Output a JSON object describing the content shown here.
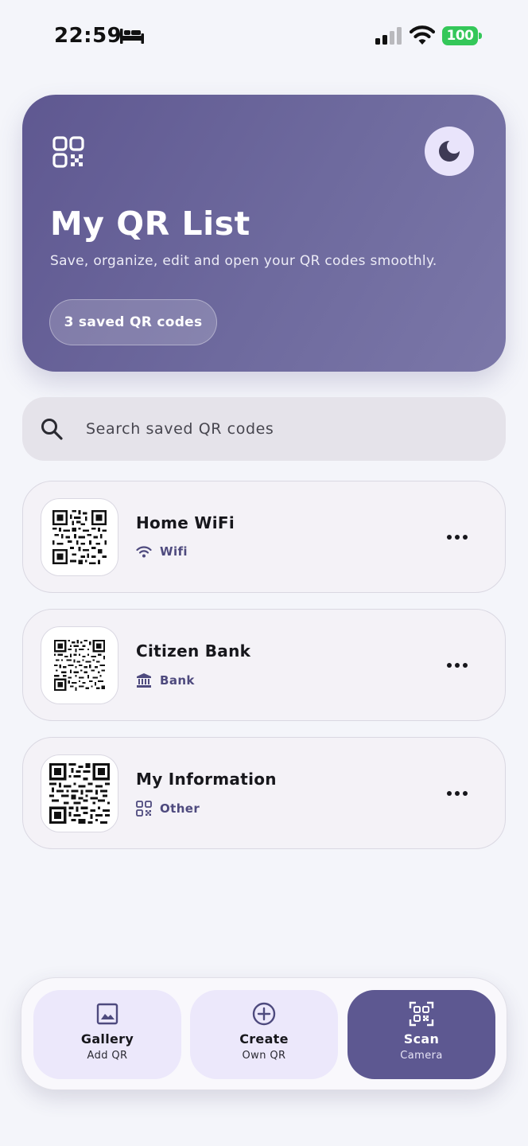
{
  "status_bar": {
    "time": "22:59",
    "battery_level": "100",
    "icons": [
      "bed-icon",
      "cellular-signal-icon",
      "wifi-icon",
      "battery-icon"
    ]
  },
  "hero": {
    "logo_icon": "qr-code-icon",
    "theme_toggle_icon": "moon-icon",
    "title": "My QR List",
    "subtitle": "Save, organize, edit and open your QR codes smoothly.",
    "count_badge": "3 saved QR codes",
    "colors": {
      "gradient_start": "#5f5891",
      "gradient_end": "#7b77a8"
    }
  },
  "search": {
    "icon": "search-icon",
    "placeholder": "Search saved QR codes"
  },
  "qr_list": [
    {
      "name": "Home WiFi",
      "type": "Wifi",
      "type_icon": "wifi-icon"
    },
    {
      "name": "Citizen Bank",
      "type": "Bank",
      "type_icon": "bank-icon"
    },
    {
      "name": "My Information",
      "type": "Other",
      "type_icon": "qr-code-icon"
    }
  ],
  "bottom_bar": {
    "gallery": {
      "label": "Gallery",
      "sub": "Add QR",
      "icon": "image-icon"
    },
    "create": {
      "label": "Create",
      "sub": "Own QR",
      "icon": "plus-circle-icon"
    },
    "scan": {
      "label": "Scan",
      "sub": "Camera",
      "icon": "qr-scan-icon"
    },
    "colors": {
      "primary": "#5d5891",
      "secondary": "#ece8fb"
    }
  }
}
